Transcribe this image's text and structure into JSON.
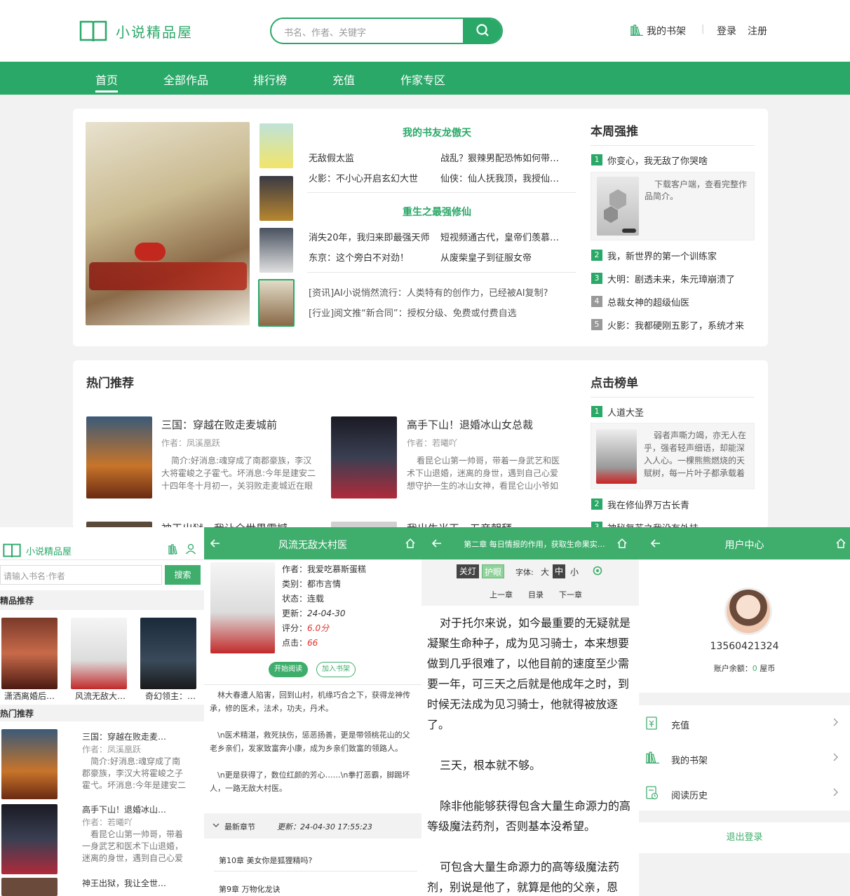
{
  "header": {
    "logo_text": "小说精品屋",
    "search_placeholder": "书名、作者、关键字",
    "bookshelf": "我的书架",
    "login": "登录",
    "register": "注册"
  },
  "nav": [
    "首页",
    "全部作品",
    "排行榜",
    "充值",
    "作家专区"
  ],
  "featured": {
    "sec1_title": "我的书友龙傲天",
    "sec1_items": [
      "无敌假太监",
      "战乱？狠辣男配恐怖如何带家…",
      "火影：不小心开启玄幻大世",
      "仙侠：仙人抚我顶，我授仙…"
    ],
    "sec2_title": "重生之最强修仙",
    "sec2_items": [
      "消失20年，我归来即最强天师",
      "短视频通古代，皇帝们羡慕…",
      "东京：这个旁白不对劲！",
      "从废柴皇子到征服女帝"
    ],
    "news": [
      "[资讯]AI小说悄然流行：人类特有的创作力，已经被AI复制?",
      "[行业]阅文推“新合同”：授权分级、免费或付费自选"
    ]
  },
  "weekly": {
    "title": "本周强推",
    "items": [
      "你变心，我无敌了你哭啥",
      "我，新世界的第一个训练家",
      "大明：剧透未来，朱元璋崩溃了",
      "总裁女神的超级仙医",
      "火影：我都硬刚五影了，系统才来"
    ],
    "nums": [
      "1",
      "2",
      "3",
      "4",
      "5"
    ],
    "desc": "下载客户端，查看完整作品简介。"
  },
  "hot": {
    "title": "热门推荐",
    "books": [
      {
        "title": "三国：穿越在败走麦城前",
        "author": "作者：凤溪凰跃",
        "intro": "简介:好消息:魂穿成了南郡豪族，李汉大将霍峻之子霍弋。坏消息:今年是建安二十四年冬十月初一，关羽败走麦城近在眼前。"
      },
      {
        "title": "高手下山！退婚冰山女总裁",
        "author": "作者：若曦吖",
        "intro": "看昆仑山第一帅哥，带着一身武艺和医术下山退婚，迷离的身世，遇到自己心爱想守护一生的冰山女神，看昆仑山小爷如何搅"
      }
    ],
    "more1": "神王出狱，我让全世界震撼",
    "more2": "我出生当天，五帝朝拜"
  },
  "clicks": {
    "title": "点击榜单",
    "items": [
      "人道大圣",
      "我在修仙界万古长青",
      "神秘复苏之我没有外挂"
    ],
    "nums": [
      "1",
      "2",
      "3"
    ],
    "desc": "弱者声嘶力竭，亦无人在乎，强者轻声细语，却能深入人心。一棵熊熊燃烧的天赋树，每一片叶子都承载着"
  },
  "m1": {
    "logo": "小说精品屋",
    "placeholder": "请输入书名·作者",
    "search_btn": "搜索",
    "sec1": "精品推荐",
    "picks": [
      "潇洒离婚后…",
      "风流无敌大…",
      "奇幻领主：…"
    ],
    "sec2": "热门推荐",
    "list": [
      {
        "title": "三国：穿越在败走麦…",
        "author": "作者：凤溪凰跃",
        "intro": "简介:好消息:魂穿成了南郡豪族，李汉大将霍峻之子霍弋。坏消息:今年是建安二十"
      },
      {
        "title": "高手下山！退婚冰山…",
        "author": "作者：若曦吖",
        "intro": "看昆仑山第一帅哥，带着一身武艺和医术下山退婚，迷离的身世，遇到自己心爱"
      }
    ],
    "more": "神王出狱，我让全世…"
  },
  "m2": {
    "title": "风流无敌大村医",
    "author": "作者：我爱吃慕斯蛋糕",
    "category": "类别：都市言情",
    "status": "状态：连载",
    "updated_label": "更新：",
    "updated": "24-04-30",
    "score_label": "评分：",
    "score": "6.0分",
    "clicks_label": "点击：",
    "clicks": "66",
    "read_btn": "开始阅读",
    "add_btn": "加入书架",
    "intro": [
      "林大春遭人陷害，回到山村，机缘巧合之下，获得龙神传承，修的医术，法术，功夫，丹术。",
      "\\n医术精湛，救死扶伤，惩恶扬善，更是带领桃花山的父老乡亲们，发家致富奔小康，成为乡亲们致富的领路人。",
      "\\n更是获得了，数位红颜的芳心……\\n拳打恶霸，脚踢坏人，一路无敌大村医。"
    ],
    "latest": "最新章节",
    "latest_update": "更新：24-04-30 17:55:23",
    "chapters": [
      "第10章 美女你是狐狸精吗?",
      "第9章 万物化龙诀"
    ]
  },
  "m3": {
    "title": "第二章 每日情报的作用，获取生命果实…",
    "lights_off": "关灯",
    "eye": "护眼",
    "font_label": "字体:",
    "font_big": "大",
    "font_mid": "中",
    "font_small": "小",
    "prev": "上一章",
    "toc": "目录",
    "next": "下一章",
    "paras": [
      "对于托尔来说，如今最重要的无疑就是凝聚生命种子，成为见习骑士，本来想要做到几乎很难了，以他目前的速度至少需要一年，可三天之后就是他成年之时，到时候无法成为见习骑士，他就得被放逐了。",
      "三天，根本就不够。",
      "除非他能够获得包含大量生命源力的高等级魔法药剂，否则基本没希望。",
      "可包含大量生命源力的高等级魔法药剂，别说是他了，就算是他的父亲，恩"
    ]
  },
  "m4": {
    "title": "用户中心",
    "phone": "13560421324",
    "balance_label": "账户余额：",
    "balance": "0",
    "balance_unit": "屋币",
    "menu": [
      "充值",
      "我的书架",
      "阅读历史"
    ],
    "logout": "退出登录"
  },
  "colors": {
    "brand": "#2aa868",
    "mobile_header": "#3fae6c",
    "score": "#e0302a"
  }
}
